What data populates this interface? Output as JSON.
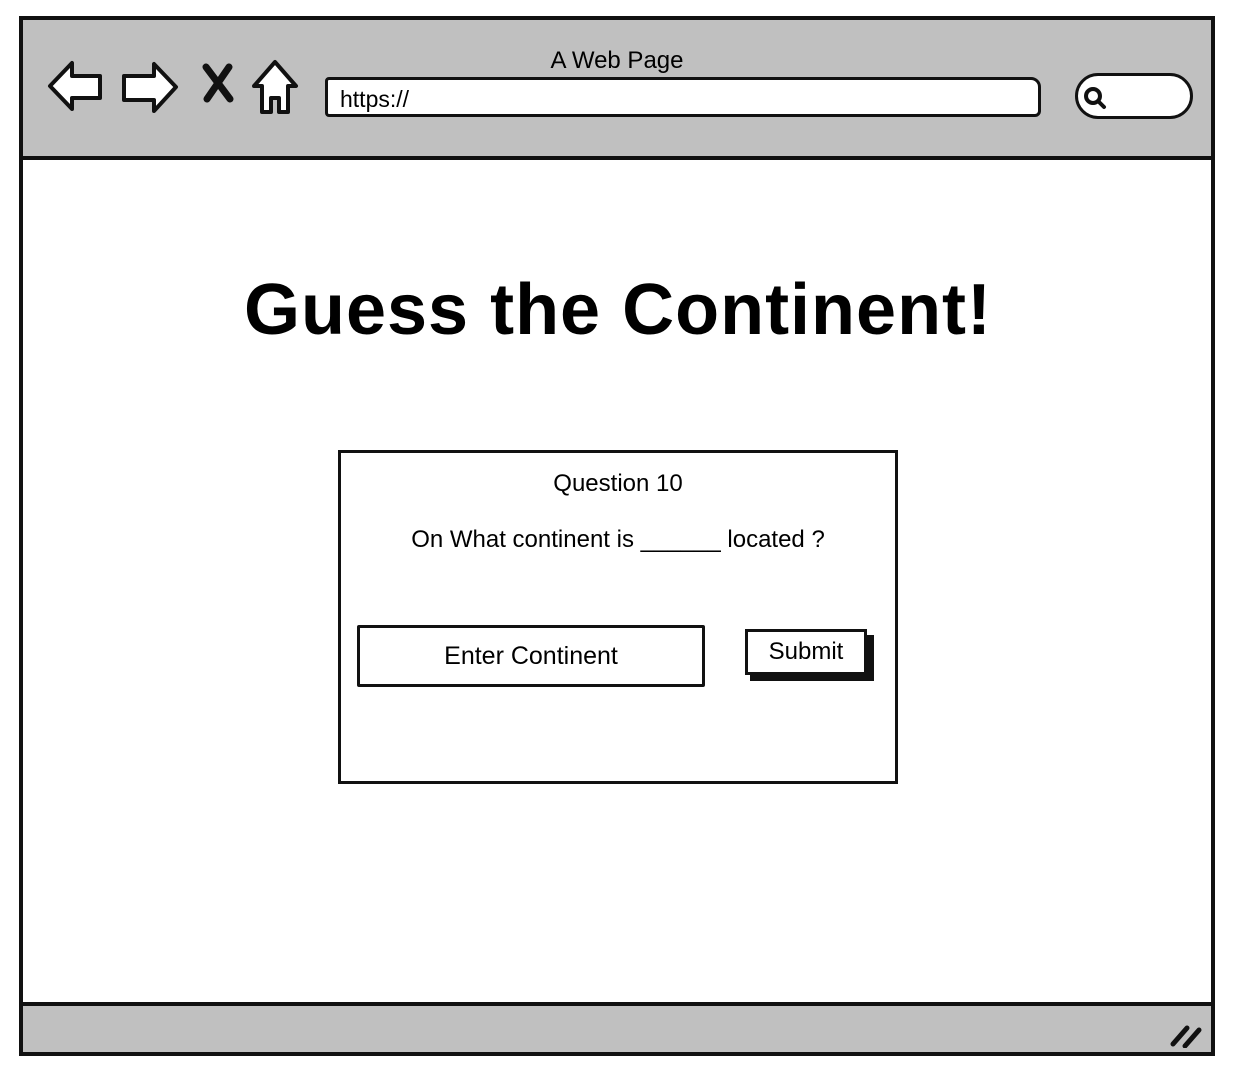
{
  "window": {
    "title": "A Web Page"
  },
  "toolbar": {
    "back_icon": "back-arrow-icon",
    "forward_icon": "forward-arrow-icon",
    "stop_icon": "close-x-icon",
    "home_icon": "home-icon",
    "search_icon": "search-icon"
  },
  "address_bar": {
    "value": "https://"
  },
  "status_bar": {
    "resize_icon": "resize-grip-icon"
  },
  "main": {
    "title": "Guess the Continent!",
    "quiz": {
      "question_label": "Question 10",
      "question_text": "On What continent is ______ located ?",
      "input_placeholder": "Enter Continent",
      "submit_label": "Submit"
    }
  },
  "colors": {
    "chrome_gray": "#c0c0c0",
    "ink": "#111111",
    "background": "#ffffff"
  }
}
